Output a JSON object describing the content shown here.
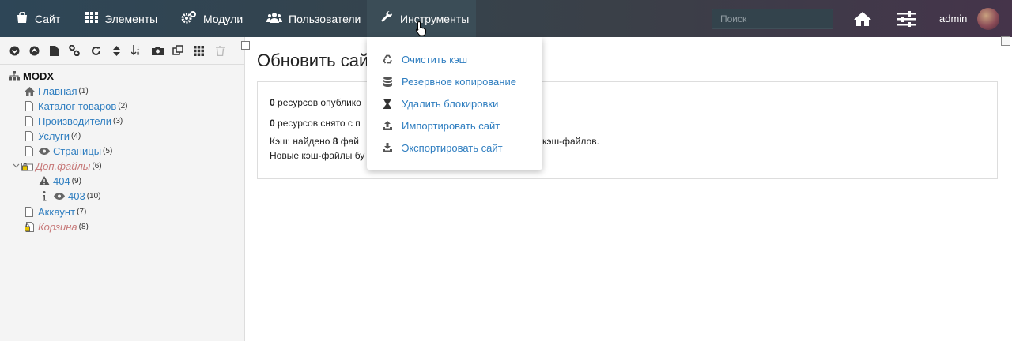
{
  "topnav": {
    "items": [
      {
        "label": "Сайт",
        "icon": "bag-icon"
      },
      {
        "label": "Элементы",
        "icon": "grid-icon"
      },
      {
        "label": "Модули",
        "icon": "cogs-icon"
      },
      {
        "label": "Пользователи",
        "icon": "users-icon"
      },
      {
        "label": "Инструменты",
        "icon": "wrench-icon"
      }
    ],
    "search_placeholder": "Поиск",
    "username": "admin"
  },
  "tree": {
    "root": "MODX",
    "nodes": [
      {
        "label": "Главная",
        "count": "(1)"
      },
      {
        "label": "Каталог товаров",
        "count": "(2)"
      },
      {
        "label": "Производители",
        "count": "(3)"
      },
      {
        "label": "Услуги",
        "count": "(4)"
      },
      {
        "label": "Страницы",
        "count": "(5)"
      },
      {
        "label": "Доп.файлы",
        "count": "(6)"
      },
      {
        "label": "404",
        "count": "(9)"
      },
      {
        "label": "403",
        "count": "(10)"
      },
      {
        "label": "Аккаунт",
        "count": "(7)"
      },
      {
        "label": "Корзина",
        "count": "(8)"
      }
    ]
  },
  "main": {
    "title": "Обновить сай",
    "line1_num": "0",
    "line1_text": " ресурсов опублико",
    "line2_num": "0",
    "line2_text": " ресурсов снято с п",
    "line3_pre": "Кэш: найдено ",
    "line3_num": "8",
    "line3_text": " фай",
    "line3_tail": "кэш-файлов.",
    "line4_text": "Новые кэш-файлы бу"
  },
  "dropdown": {
    "items": [
      {
        "label": "Очистить кэш"
      },
      {
        "label": "Резервное копирование"
      },
      {
        "label": "Удалить блокировки"
      },
      {
        "label": "Импортировать сайт"
      },
      {
        "label": "Экспортировать сайт"
      }
    ]
  },
  "colors": {
    "accent": "#2f7ec0",
    "unpublished": "#c77a7a",
    "topbar": "#33444f"
  }
}
